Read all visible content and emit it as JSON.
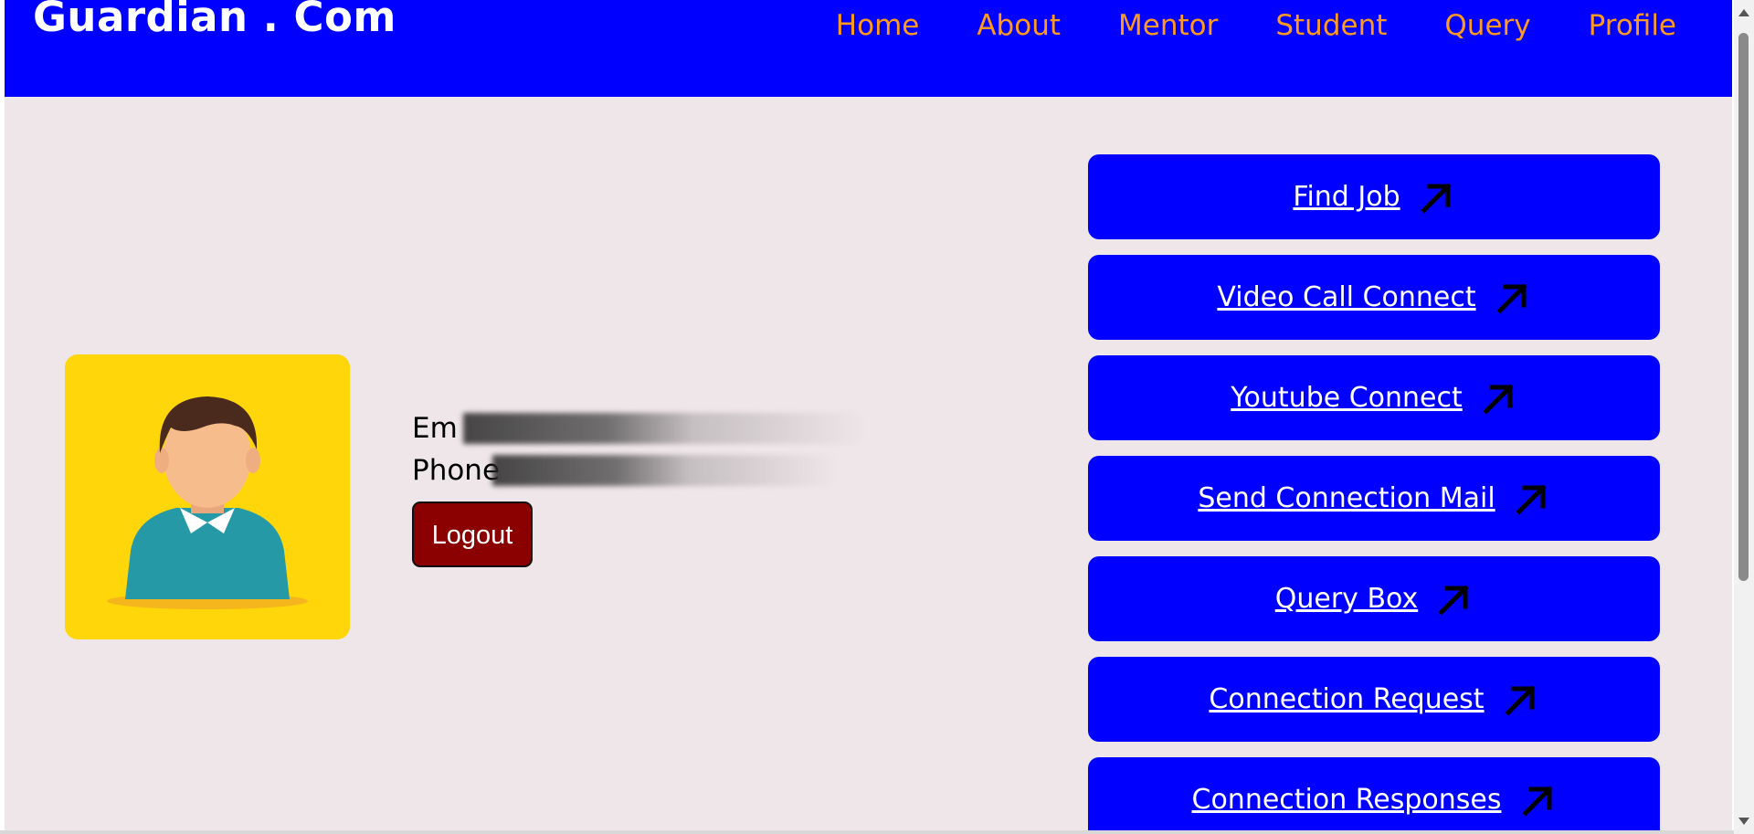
{
  "header": {
    "brand": "Guardian . Com",
    "nav": [
      "Home",
      "About",
      "Mentor",
      "Student",
      "Query",
      "Profile"
    ]
  },
  "profile": {
    "avatar_icon": "user-avatar-icon",
    "email_label": "Em",
    "phone_label": "Phone",
    "logout_label": "Logout"
  },
  "actions": [
    {
      "label": "Find Job",
      "icon": "arrow-up-right-icon"
    },
    {
      "label": "Video Call Connect",
      "icon": "arrow-up-right-icon"
    },
    {
      "label": "Youtube Connect",
      "icon": "arrow-up-right-icon"
    },
    {
      "label": "Send Connection Mail",
      "icon": "arrow-up-right-icon"
    },
    {
      "label": "Query Box",
      "icon": "arrow-up-right-icon"
    },
    {
      "label": "Connection Request",
      "icon": "arrow-up-right-icon"
    },
    {
      "label": "Connection Responses",
      "icon": "arrow-up-right-icon"
    }
  ],
  "colors": {
    "nav_bg": "#0000ff",
    "nav_link": "#ff9a1f",
    "page_bg": "#efe6e9",
    "avatar_bg": "#ffd60a",
    "logout_bg": "#8b0000",
    "action_bg": "#0000ff"
  }
}
